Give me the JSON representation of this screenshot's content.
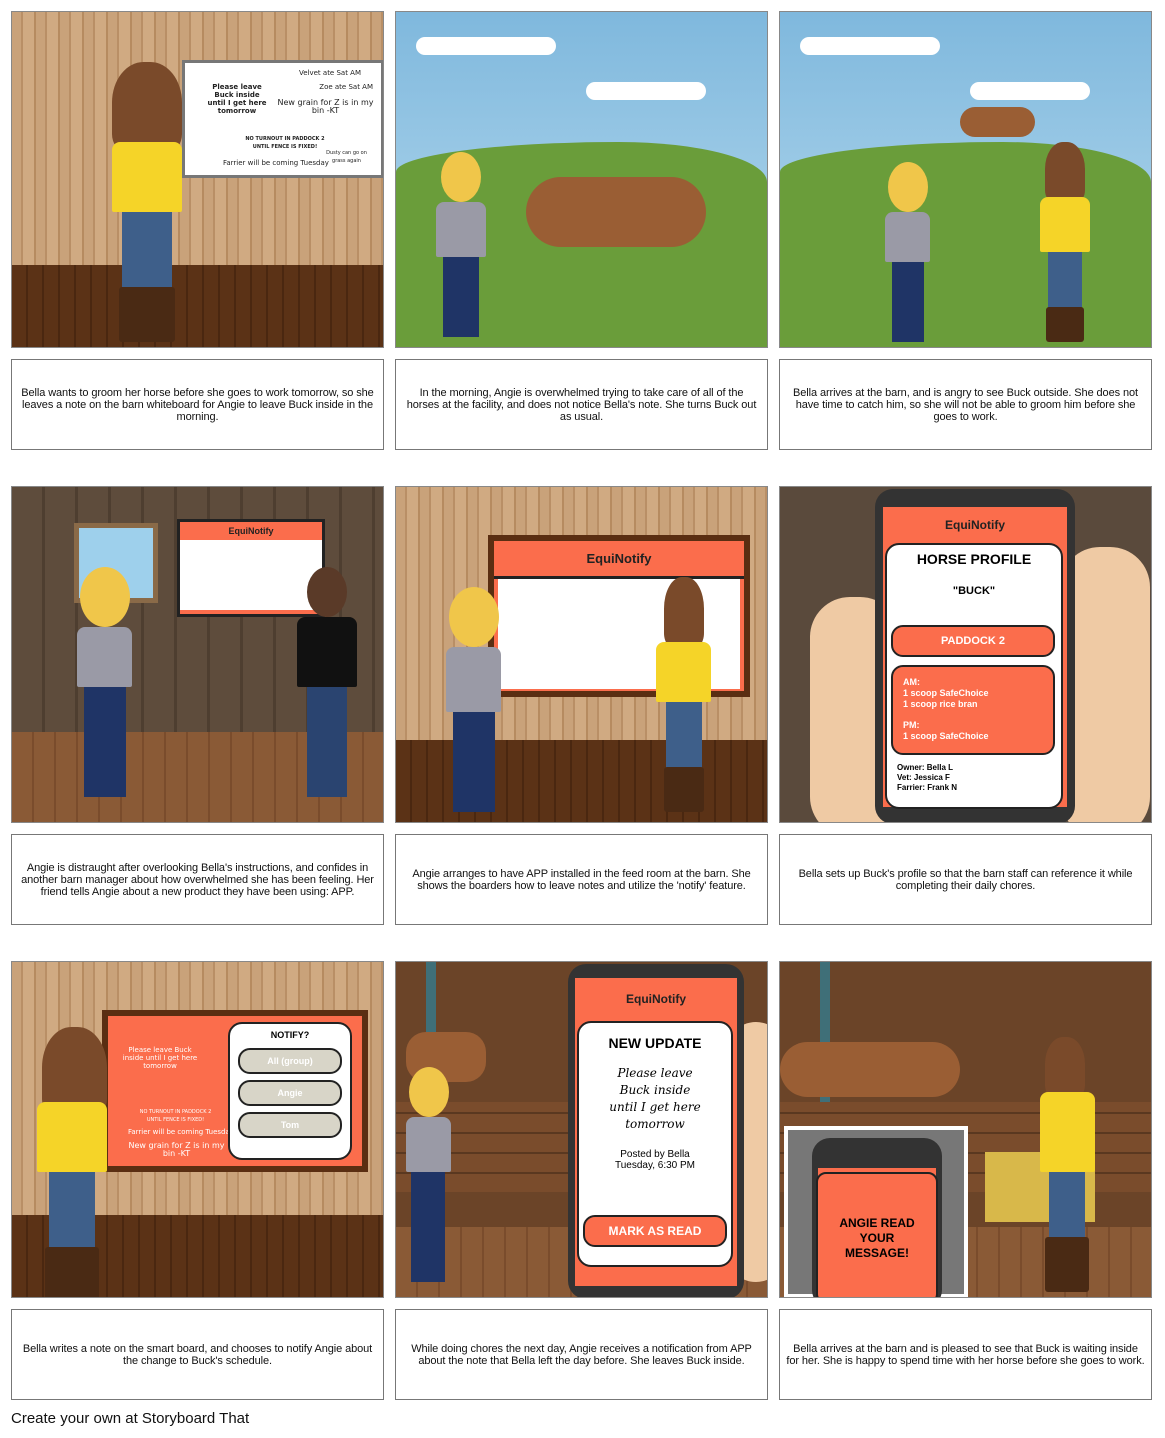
{
  "brand": "EquiNotify",
  "colors": {
    "accent": "#fb6d4c",
    "wood": "#c9a27a",
    "floor": "#5b3216",
    "grass": "#6a9d3a",
    "sky": "#7fb8dd"
  },
  "panels": [
    {
      "caption": "Bella wants to groom her horse before she goes to work tomorrow, so she leaves a note on the barn whiteboard for Angie to leave Buck inside in the morning.",
      "whiteboard": [
        "Velvet ate Sat AM",
        "Zoe ate Sat AM",
        "Please leave Buck inside until I get here tomorrow",
        "New grain for Z is in my bin -KT",
        "NO TURNOUT IN PADDOCK 2 UNTIL FENCE IS FIXED!",
        "Dusty can go on grass again",
        "Farrier will be coming Tuesday"
      ]
    },
    {
      "caption": "In the morning, Angie is overwhelmed trying to take care of all of the horses at the facility, and does not notice Bella's note. She turns Buck out as usual."
    },
    {
      "caption": "Bella arrives at the barn, and is angry to see Buck outside. She does not have time to catch him, so she will not be able to groom him before she goes to work."
    },
    {
      "caption": "Angie is distraught after overlooking Bella's instructions, and confides in another barn manager about how overwhelmed she has been feeling. Her friend tells Angie about a new product they have been using: APP."
    },
    {
      "caption": "Angie arranges to have APP installed in the feed room at the barn. She shows the boarders how to leave notes and utilize the 'notify' feature."
    },
    {
      "caption": "Bella sets up Buck's profile so that the barn staff can reference it while completing their daily chores.",
      "profile": {
        "title": "HORSE PROFILE",
        "name": "\"BUCK\"",
        "paddock": "PADDOCK 2",
        "am_label": "AM:",
        "am_1": "1 scoop SafeChoice",
        "am_2": "1 scoop rice bran",
        "pm_label": "PM:",
        "pm_1": "1 scoop SafeChoice",
        "owner": "Owner: Bella L",
        "vet": "Vet: Jessica F",
        "farrier": "Farrier: Frank N"
      }
    },
    {
      "caption": "Bella writes a note on the smart board, and chooses to notify Angie about the change to Buck's schedule.",
      "notify": {
        "title": "NOTIFY?",
        "options": [
          "All (group)",
          "Angie",
          "Tom"
        ]
      }
    },
    {
      "caption": "While doing chores the next day, Angie receives a notification from APP about the note that Bella left the day before. She leaves Buck inside.",
      "update": {
        "title": "NEW UPDATE",
        "message": "Please leave Buck inside until I get here tomorrow",
        "posted": "Posted by Bella",
        "time": "Tuesday, 6:30 PM",
        "button": "MARK AS READ"
      }
    },
    {
      "caption": "Bella arrives at the barn and is pleased to see that Buck is waiting inside for her. She is happy to spend time with her horse before she goes to work.",
      "message": "ANGIE READ YOUR MESSAGE!"
    }
  ],
  "footer": "Create your own at Storyboard That"
}
